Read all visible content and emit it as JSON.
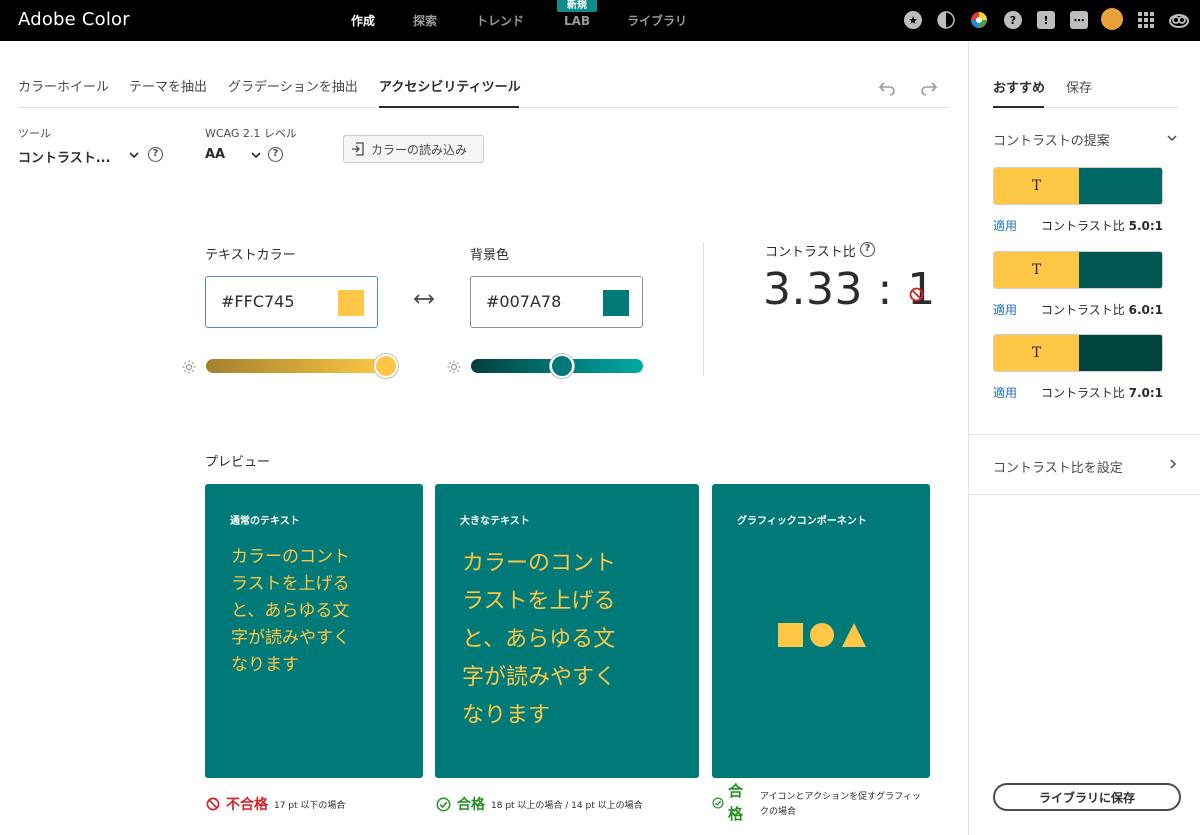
{
  "app": {
    "title": "Adobe Color"
  },
  "nav": {
    "items": [
      "作成",
      "探索",
      "トレンド",
      "LAB",
      "ライブラリ"
    ],
    "new_badge": "新規"
  },
  "tabs": [
    "カラーホイール",
    "テーマを抽出",
    "グラデーションを抽出",
    "アクセシビリティツール"
  ],
  "controls": {
    "tool_label": "ツール",
    "tool_value": "コントラスト...",
    "wcag_label": "WCAG 2.1 レベル",
    "wcag_value": "AA",
    "import_label": "カラーの読み込み",
    "help_glyph": "?"
  },
  "colors": {
    "text_label": "テキストカラー",
    "text_hex": "#FFC745",
    "bg_label": "背景色",
    "bg_hex": "#007A78",
    "text_brightness": 1.0,
    "bg_brightness": 0.5
  },
  "contrast": {
    "label": "コントラスト比",
    "value": "3.33 : 1"
  },
  "preview": {
    "label": "プレビュー",
    "cards": [
      {
        "title": "通常のテキスト",
        "lines": [
          "カラーのコント",
          "ラストを上げる",
          "と、あらゆる文",
          "字が読みやすく",
          "なります"
        ]
      },
      {
        "title": "大きなテキスト",
        "lines": [
          "カラーのコント",
          "ラストを上げる",
          "と、あらゆる文",
          "字が読みやすく",
          "なります"
        ]
      },
      {
        "title": "グラフィックコンポーネント"
      }
    ],
    "results": [
      {
        "status": "不合格",
        "note": "17 pt 以下の場合"
      },
      {
        "status": "合格",
        "note": "18 pt 以上の場合 / 14 pt 以上の場合"
      },
      {
        "status": "合格",
        "note": "アイコンとアクションを促すグラフィックの場合"
      }
    ]
  },
  "sidebar": {
    "tabs": [
      "おすすめ",
      "保存"
    ],
    "suggestions_title": "コントラストの提案",
    "suggestions": [
      {
        "glyph": "T",
        "bg": "#006864",
        "apply": "適用",
        "ratio_label": "コントラスト比",
        "ratio": "5.0:1"
      },
      {
        "glyph": "T",
        "bg": "#005650",
        "apply": "適用",
        "ratio_label": "コントラスト比",
        "ratio": "6.0:1"
      },
      {
        "glyph": "T",
        "bg": "#00443f",
        "apply": "適用",
        "ratio_label": "コントラスト比",
        "ratio": "7.0:1"
      }
    ],
    "set_contrast": "コントラスト比を設定",
    "save_button": "ライブラリに保存"
  },
  "palette": {
    "text": "#FFC745",
    "background": "#007A78",
    "pass": "#268e22",
    "fail": "#d3222a",
    "link": "#1f6fbf"
  }
}
